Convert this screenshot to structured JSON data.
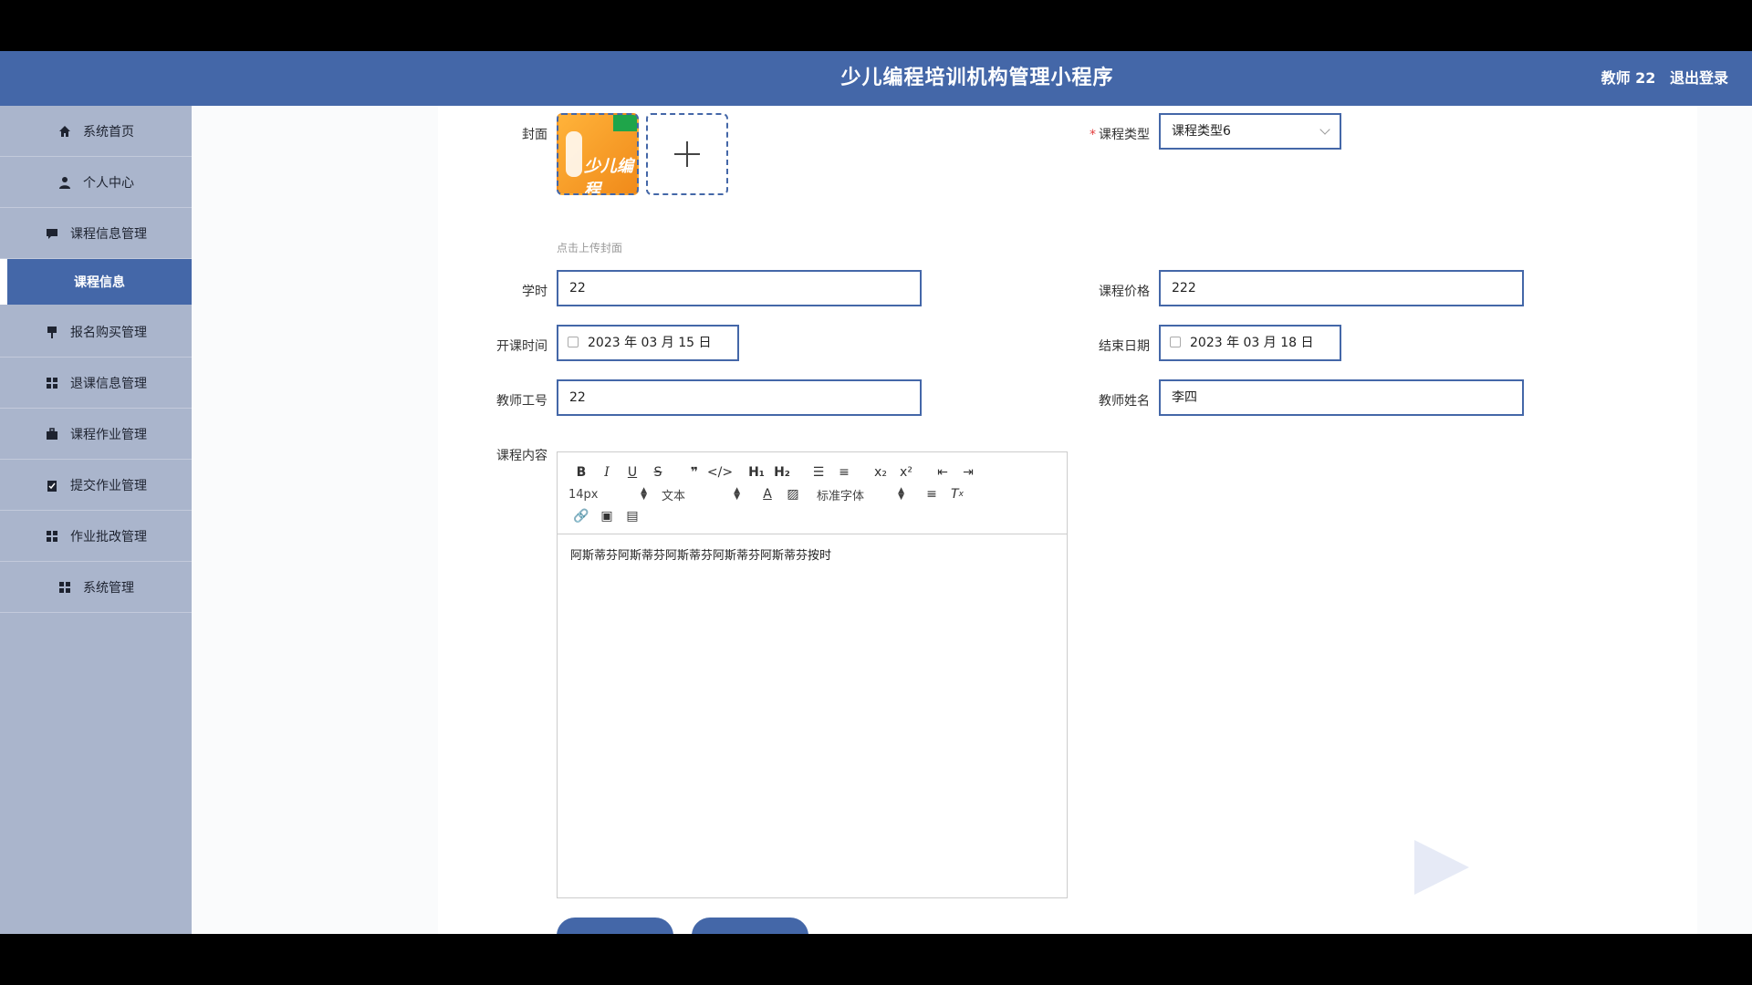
{
  "header": {
    "title": "少儿编程培训机构管理小程序",
    "user_label": "教师 22",
    "logout_label": "退出登录"
  },
  "sidebar": {
    "items": [
      {
        "label": "系统首页",
        "icon": "home-icon"
      },
      {
        "label": "个人中心",
        "icon": "user-icon"
      },
      {
        "label": "课程信息管理",
        "icon": "chat-icon"
      },
      {
        "label": "课程信息",
        "icon": "",
        "active": true
      },
      {
        "label": "报名购买管理",
        "icon": "sign-icon"
      },
      {
        "label": "退课信息管理",
        "icon": "grid-icon"
      },
      {
        "label": "课程作业管理",
        "icon": "briefcase-icon"
      },
      {
        "label": "提交作业管理",
        "icon": "clipboard-icon"
      },
      {
        "label": "作业批改管理",
        "icon": "grid-icon"
      },
      {
        "label": "系统管理",
        "icon": "grid-icon"
      }
    ]
  },
  "form": {
    "cover": {
      "label": "封面",
      "hint": "点击上传封面",
      "image_text": "少儿编程"
    },
    "course_type": {
      "label": "课程类型",
      "value": "课程类型6"
    },
    "hours": {
      "label": "学时",
      "value": "22"
    },
    "price": {
      "label": "课程价格",
      "value": "222"
    },
    "start_date": {
      "label": "开课时间",
      "value": "2023 年 03 月 15 日"
    },
    "end_date": {
      "label": "结束日期",
      "value": "2023 年 03 月 18 日"
    },
    "teacher_id": {
      "label": "教师工号",
      "value": "22"
    },
    "teacher_name": {
      "label": "教师姓名",
      "value": "李四"
    },
    "content": {
      "label": "课程内容",
      "toolbar": {
        "font_size": "14px",
        "block_format": "文本",
        "font_family": "标准字体"
      },
      "text": "阿斯蒂芬阿斯蒂芬阿斯蒂芬阿斯蒂芬阿斯蒂芬按时"
    }
  },
  "colors": {
    "primary": "#4467a8",
    "sidebar": "#aab5cc"
  }
}
